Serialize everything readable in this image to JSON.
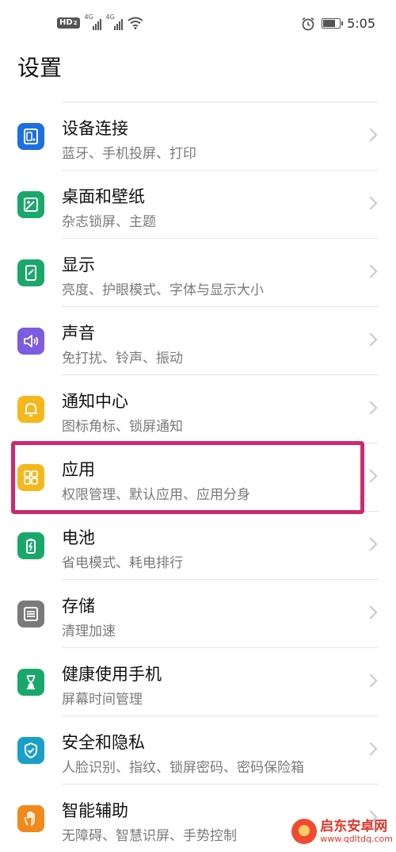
{
  "status_bar": {
    "hd_badge": "HD",
    "hd_badge_sub": "2",
    "signal_1_label": "4G",
    "signal_2_label": "4G",
    "time": "5:05",
    "icons": [
      "hd-icon",
      "signal-icon",
      "signal-icon",
      "wifi-icon",
      "alarm-icon",
      "battery-icon"
    ]
  },
  "page": {
    "title": "设置"
  },
  "settings": [
    {
      "title": "设备连接",
      "subtitle": "蓝牙、手机投屏、打印",
      "icon": "device-connect-icon",
      "color": "#1e6fe0"
    },
    {
      "title": "桌面和壁纸",
      "subtitle": "杂志锁屏、主题",
      "icon": "wallpaper-icon",
      "color": "#1aa86a"
    },
    {
      "title": "显示",
      "subtitle": "亮度、护眼模式、字体与显示大小",
      "icon": "display-icon",
      "color": "#1aa86a"
    },
    {
      "title": "声音",
      "subtitle": "免打扰、铃声、振动",
      "icon": "sound-icon",
      "color": "#7c5ce0"
    },
    {
      "title": "通知中心",
      "subtitle": "图标角标、锁屏通知",
      "icon": "notification-icon",
      "color": "#f5b81c"
    },
    {
      "title": "应用",
      "subtitle": "权限管理、默认应用、应用分身",
      "icon": "apps-icon",
      "color": "#f5b81c"
    },
    {
      "title": "电池",
      "subtitle": "省电模式、耗电排行",
      "icon": "battery-icon",
      "color": "#1aa86a"
    },
    {
      "title": "存储",
      "subtitle": "清理加速",
      "icon": "storage-icon",
      "color": "#7a7a7a"
    },
    {
      "title": "健康使用手机",
      "subtitle": "屏幕时间管理",
      "icon": "hourglass-icon",
      "color": "#1aa86a"
    },
    {
      "title": "安全和隐私",
      "subtitle": "人脸识别、指纹、锁屏密码、密码保险箱",
      "icon": "shield-icon",
      "color": "#1aa0c8"
    },
    {
      "title": "智能辅助",
      "subtitle": "无障碍、智慧识屏、手势控制",
      "icon": "hand-icon",
      "color": "#f08a1c"
    }
  ],
  "highlight_color": "#d0286e",
  "watermark": {
    "name": "启东安卓网",
    "url": "www.qdltdq.com"
  }
}
